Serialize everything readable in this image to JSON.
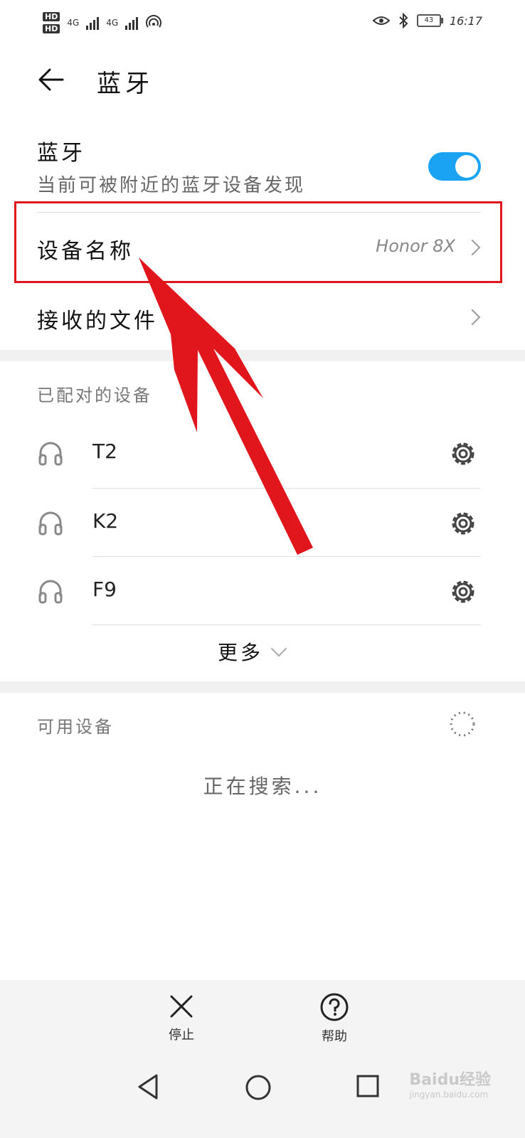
{
  "status_bar": {
    "hd1": "HD",
    "hd2": "HD",
    "net1": "4G",
    "net2": "4G",
    "time": "16:17",
    "battery": "43"
  },
  "header": {
    "title": "蓝牙"
  },
  "bluetooth": {
    "title": "蓝牙",
    "subtitle": "当前可被附近的蓝牙设备发现",
    "enabled": true,
    "accent_color": "#1aa3f2"
  },
  "device_name_row": {
    "label": "设备名称",
    "value": "Honor 8X"
  },
  "received_files_row": {
    "label": "接收的文件"
  },
  "paired": {
    "title": "已配对的设备",
    "devices": [
      {
        "name": "T2",
        "icon": "headphones-icon"
      },
      {
        "name": "K2",
        "icon": "headphones-icon"
      },
      {
        "name": "F9",
        "icon": "headphones-icon"
      }
    ],
    "more_label": "更多"
  },
  "available": {
    "title": "可用设备",
    "searching_text": "正在搜索..."
  },
  "bottom_actions": {
    "stop_label": "停止",
    "help_label": "帮助"
  },
  "watermark": {
    "text": "Baidu经验",
    "sub": "jingyan.baidu.com"
  },
  "annotation_color": "#e1161c"
}
